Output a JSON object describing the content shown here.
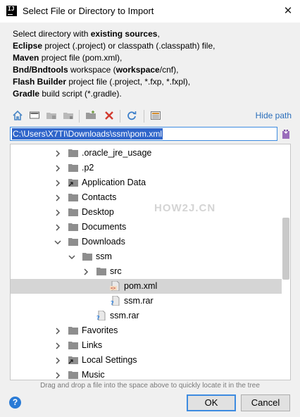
{
  "window": {
    "title": "Select File or Directory to Import",
    "app_icon_text": "IJ"
  },
  "description": [
    [
      {
        "t": "Select directory with ",
        "b": false
      },
      {
        "t": "existing sources",
        "b": true
      },
      {
        "t": ",",
        "b": false
      }
    ],
    [
      {
        "t": "Eclipse",
        "b": true
      },
      {
        "t": " project (.project) or classpath (.classpath) file,",
        "b": false
      }
    ],
    [
      {
        "t": "Maven",
        "b": true
      },
      {
        "t": " project file (pom.xml),",
        "b": false
      }
    ],
    [
      {
        "t": "Bnd/Bndtools",
        "b": true
      },
      {
        "t": " workspace (",
        "b": false
      },
      {
        "t": "workspace",
        "b": true
      },
      {
        "t": "/cnf),",
        "b": false
      }
    ],
    [
      {
        "t": "Flash Builder",
        "b": true
      },
      {
        "t": " project file (.project, *.fxp, *.fxpl),",
        "b": false
      }
    ],
    [
      {
        "t": "Gradle",
        "b": true
      },
      {
        "t": " build script (*.gradle).",
        "b": false
      }
    ]
  ],
  "toolbar": {
    "icons": [
      "home-icon",
      "desktop-icon",
      "project-folder-icon",
      "module-folder-icon",
      "new-folder-icon",
      "delete-icon",
      "refresh-icon",
      "show-hidden-icon"
    ],
    "hide_path": "Hide path"
  },
  "path": {
    "value": "C:\\Users\\X7TI\\Downloads\\ssm\\pom.xml"
  },
  "tree": [
    {
      "label": ".oracle_jre_usage",
      "depth": 0,
      "arrow": "right",
      "icon": "folder"
    },
    {
      "label": ".p2",
      "depth": 0,
      "arrow": "right",
      "icon": "folder"
    },
    {
      "label": "Application Data",
      "depth": 0,
      "arrow": "right",
      "icon": "folder-link"
    },
    {
      "label": "Contacts",
      "depth": 0,
      "arrow": "right",
      "icon": "folder"
    },
    {
      "label": "Desktop",
      "depth": 0,
      "arrow": "right",
      "icon": "folder"
    },
    {
      "label": "Documents",
      "depth": 0,
      "arrow": "right",
      "icon": "folder"
    },
    {
      "label": "Downloads",
      "depth": 0,
      "arrow": "down",
      "icon": "folder"
    },
    {
      "label": "ssm",
      "depth": 1,
      "arrow": "down",
      "icon": "folder"
    },
    {
      "label": "src",
      "depth": 2,
      "arrow": "right",
      "icon": "folder"
    },
    {
      "label": "pom.xml",
      "depth": 3,
      "arrow": "none",
      "icon": "maven",
      "selected": true
    },
    {
      "label": "ssm.rar",
      "depth": 3,
      "arrow": "none",
      "icon": "unknown-file"
    },
    {
      "label": "ssm.rar",
      "depth": 2,
      "arrow": "none",
      "icon": "unknown-file"
    },
    {
      "label": "Favorites",
      "depth": 0,
      "arrow": "right",
      "icon": "folder"
    },
    {
      "label": "Links",
      "depth": 0,
      "arrow": "right",
      "icon": "folder"
    },
    {
      "label": "Local Settings",
      "depth": 0,
      "arrow": "right",
      "icon": "folder-link"
    },
    {
      "label": "Music",
      "depth": 0,
      "arrow": "right",
      "icon": "folder"
    }
  ],
  "watermark": "HOW2J.CN",
  "hint": "Drag and drop a file into the space above to quickly locate it in the tree",
  "buttons": {
    "ok": "OK",
    "cancel": "Cancel",
    "help": "?"
  }
}
